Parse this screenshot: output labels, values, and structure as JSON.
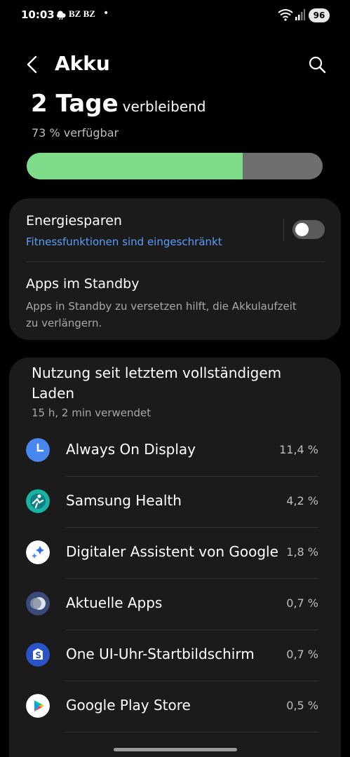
{
  "status_bar": {
    "time": "10:03",
    "carriers": "BZ BZ",
    "dot": "•",
    "battery_level": "96"
  },
  "header": {
    "title": "Akku",
    "back_icon": "chevron-left-icon",
    "search_icon": "search-icon"
  },
  "battery": {
    "remaining_value": "2 Tage",
    "remaining_label": "verbleibend",
    "available_text": "73 % verfügbar",
    "level_fraction": 0.73,
    "fill_color": "#7fdc8a",
    "track_color": "#6f6f6f"
  },
  "settings_card": {
    "power_saving": {
      "title": "Energiesparen",
      "subtitle": "Fitnessfunktionen sind eingeschränkt",
      "enabled": false
    },
    "standby_apps": {
      "title": "Apps im Standby",
      "subtitle_line1": "Apps in Standby zu versetzen hilft, die Akkulaufzeit",
      "subtitle_line2": "zu verlängern."
    }
  },
  "usage_card": {
    "title": "Nutzung seit letztem vollständigem Laden",
    "duration": "15 h, 2 min verwendet",
    "apps": [
      {
        "name": "Always On Display",
        "percent": "11,4 %",
        "icon": "clock-icon",
        "color": "#4a86f0"
      },
      {
        "name": "Samsung Health",
        "percent": "4,2 %",
        "icon": "health-icon",
        "color": "#19b3a3"
      },
      {
        "name": "Digitaler Assistent von Google",
        "percent": "1,8 %",
        "icon": "google-assistant-icon",
        "color": "#ffffff"
      },
      {
        "name": "Aktuelle Apps",
        "percent": "0,7 %",
        "icon": "recent-apps-icon",
        "color": "#3a4a78"
      },
      {
        "name": "One UI-Uhr-Startbildschirm",
        "percent": "0,7 %",
        "icon": "watch-home-icon",
        "color": "#2b53c8"
      },
      {
        "name": "Google Play Store",
        "percent": "0,5 %",
        "icon": "play-store-icon",
        "color": "#ffffff"
      }
    ]
  }
}
